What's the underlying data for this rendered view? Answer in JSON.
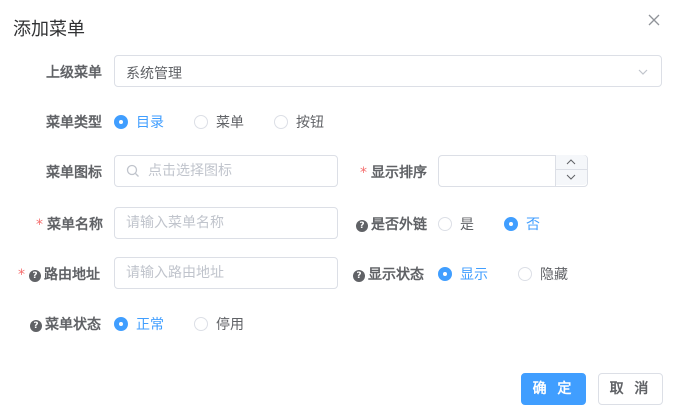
{
  "dialog": {
    "title": "添加菜单"
  },
  "form": {
    "parent_menu": {
      "label": "上级菜单",
      "value": "系统管理"
    },
    "menu_type": {
      "label": "菜单类型",
      "options": [
        "目录",
        "菜单",
        "按钮"
      ],
      "selected": "目录"
    },
    "menu_icon": {
      "label": "菜单图标",
      "placeholder": "点击选择图标"
    },
    "sort_order": {
      "label": "显示排序",
      "required_mark": "*",
      "value": ""
    },
    "menu_name": {
      "label": "菜单名称",
      "required_mark": "*",
      "placeholder": "请输入菜单名称"
    },
    "is_external": {
      "label": "是否外链",
      "help_icon": "?",
      "options": [
        "是",
        "否"
      ],
      "selected": "否"
    },
    "route_path": {
      "label": "路由地址",
      "required_mark": "*",
      "help_icon": "?",
      "placeholder": "请输入路由地址"
    },
    "visible": {
      "label": "显示状态",
      "help_icon": "?",
      "options": [
        "显示",
        "隐藏"
      ],
      "selected": "显示"
    },
    "menu_status": {
      "label": "菜单状态",
      "help_icon": "?",
      "options": [
        "正常",
        "停用"
      ],
      "selected": "正常"
    }
  },
  "footer": {
    "confirm_label": "确 定",
    "cancel_label": "取 消"
  },
  "colors": {
    "primary": "#409eff",
    "required": "#f56c6c",
    "text": "#606266",
    "border": "#dcdfe6",
    "placeholder": "#c0c4cc"
  },
  "icons": [
    "close-icon",
    "chevron-down-icon",
    "search-icon",
    "chevron-up-icon",
    "question-circle-icon"
  ]
}
